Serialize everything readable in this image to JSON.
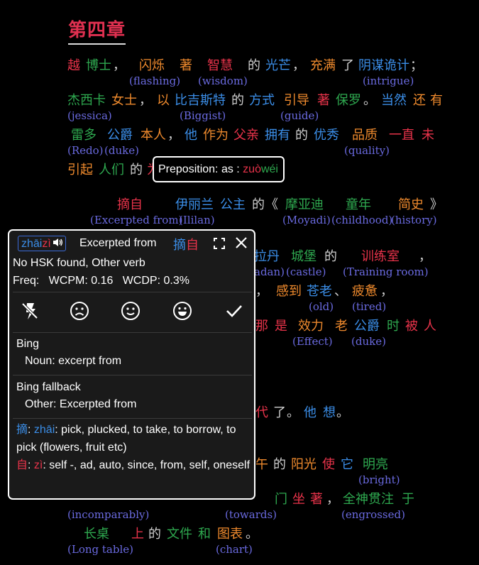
{
  "chapter_title": "第四章",
  "reader": {
    "line1": {
      "w1": "越",
      "w2": "博士",
      "p1": "，",
      "w3": "闪烁",
      "w4": "著",
      "w5": "智慧",
      "w6": "的",
      "w7": "光芒",
      "p2": "，",
      "w8": "充满",
      "w9": "了",
      "w10": "阴谋诡计",
      "p3": "；",
      "g1": "(flashing)",
      "g2": "(wisdom)",
      "g3": "(intrigue)"
    },
    "line2": {
      "w1": "杰西卡",
      "w2": "女士",
      "p1": "，",
      "w3": "以",
      "w4": "比吉斯特",
      "w5": "的",
      "w6": "方式",
      "w7": "引导",
      "w8": "著",
      "w9": "保罗",
      "p2": "。",
      "w10": "当然",
      "w11": "还",
      "w12": "有",
      "g1": "(jessica)",
      "g2": "(Biggist)",
      "g3": "(guide)"
    },
    "line3": {
      "w1": "雷多",
      "w2": "公爵",
      "w3": "本人",
      "p1": "，",
      "w4": "他",
      "w5": "作为",
      "w6": "父亲",
      "w7": "拥有",
      "w8": "的",
      "w9": "优秀",
      "w10": "品质",
      "w11": "一直",
      "w12": "未",
      "g1": "(Redo)",
      "g2": "(duke)",
      "g3": "(quality)"
    },
    "line4": {
      "w1": "引起",
      "w2": "人们",
      "w3": "的"
    },
    "line5": {
      "w1": "摘自",
      "w2": "伊丽兰",
      "w3": "公主",
      "w4": "的",
      "p1": "《",
      "w5": "摩亚迪",
      "w6": "童年",
      "w7": "简史",
      "p2": "》",
      "g1": "(Excerpted from)",
      "g2": "(Ililan)",
      "g3": "(Moyadi)",
      "g4": "(childhood)",
      "g5": "(history)"
    },
    "line6": {
      "w1": "拉丹",
      "w2": "城堡",
      "w3": "的",
      "w4": "训练室",
      "p1": "，",
      "g1": "adan)",
      "g2": "(castle)",
      "g3": "(Training room)"
    },
    "line7": {
      "p1": "，",
      "w1": "感到",
      "w2": "苍老",
      "p2": "、",
      "w3": "疲惫",
      "p3": "，",
      "g1": "(old)",
      "g2": "(tired)"
    },
    "line8": {
      "w1": "那",
      "w2": "是",
      "w3": "效力",
      "w4": "老",
      "w5": "公爵",
      "w6": "时",
      "w7": "被",
      "w8": "人",
      "g1": "(Effect)",
      "g2": "(duke)"
    },
    "line9": {
      "w1": "代",
      "w2": "了",
      "p1": "。",
      "w3": "他",
      "w4": "想",
      "p2": "。"
    },
    "line10": {
      "w1": "午",
      "w2": "的",
      "w3": "阳光",
      "w4": "使",
      "w5": "它",
      "w6": "明亮",
      "g1": "(bright)"
    },
    "line11": {
      "w1": "门",
      "w2": "坐",
      "w3": "著",
      "p1": "，",
      "w4": "全神贯注",
      "w5": "于",
      "g1": "(incomparably)",
      "g2": "(towards)",
      "g3": "(engrossed)"
    },
    "line12": {
      "w1": "长桌",
      "w2": "上",
      "w3": "的",
      "w4": "文件",
      "w5": "和",
      "w6": "图表",
      "p1": "。",
      "g1": "(Long table)",
      "g2": "(chart)"
    }
  },
  "tooltip": {
    "label": "Preposition: as : ",
    "py1": "zuò",
    "py2": "wéi"
  },
  "popup": {
    "pinyin_1": "zhāi",
    "pinyin_2": "zì",
    "speaker_icon": "speaker-icon",
    "title": "Excerpted from",
    "word_1": "摘",
    "word_2": "自",
    "hsk": "No HSK found, Other verb",
    "freq": "Freq:   WCPM: 0.16   WCDP: 0.3%",
    "bing_label": "Bing",
    "bing_def": "Noun: excerpt from",
    "fallback_label": "Bing fallback",
    "fallback_def": "Other: Excerpted from",
    "char1": "摘",
    "char1_py": "zhāi",
    "char1_def": ": pick, plucked, to take, to borrow, to pick (flowers, fruit etc)",
    "char2": "自",
    "char2_py": "zì",
    "char2_def": ": self -, ad, auto, since, from, self, oneself"
  }
}
